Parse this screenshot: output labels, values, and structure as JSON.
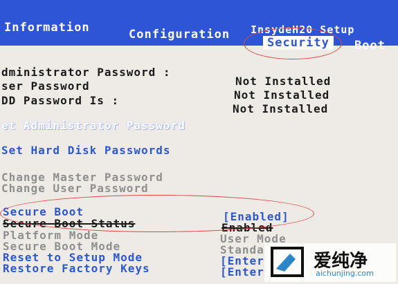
{
  "vendor": "InsydeH20 Setup",
  "menu": {
    "information": "Information",
    "configuration": "Configuration",
    "security": "Security",
    "boot": "Boot"
  },
  "passwords": [
    {
      "label": "dministrator Password :",
      "value": "Not Installed"
    },
    {
      "label": "ser Password",
      "value": "Not Installed"
    },
    {
      "label": "DD Password Is :",
      "value": "Not Installed"
    }
  ],
  "actions": {
    "set_admin": "et Administrator Password",
    "set_hdd": "Set Hard Disk Passwords",
    "change_master": "Change Master Password",
    "change_user": "Change User Password"
  },
  "secure_boot": {
    "label": "Secure Boot",
    "value": "[Enabled]"
  },
  "secure_boot_status": {
    "label": "Secure Boot Status",
    "value": "Enabled"
  },
  "platform_mode": {
    "label": "Platform Mode",
    "value": "User Mode"
  },
  "secure_boot_mode": {
    "label": "Secure Boot Mode",
    "value": "Standa"
  },
  "reset_setup": {
    "label": "Reset to Setup Mode",
    "value": "[Enter"
  },
  "restore_keys": {
    "label": "Restore Factory Keys",
    "value": "[Enter"
  },
  "watermark": {
    "brand": "爱纯净",
    "url": "aichunjing.com"
  },
  "colors": {
    "menu_bg": "#2d55d6",
    "highlight": "#2c57d2",
    "annotation": "#dd4444"
  }
}
